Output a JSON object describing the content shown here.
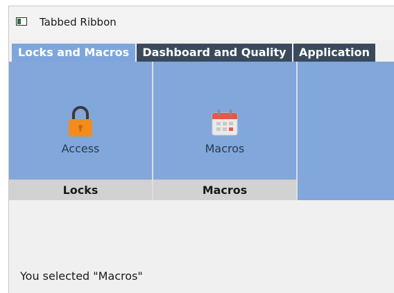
{
  "window": {
    "title": "Tabbed Ribbon",
    "icon": "window-app-icon"
  },
  "tabs": [
    {
      "label": "Locks and Macros",
      "active": true
    },
    {
      "label": "Dashboard and Quality",
      "active": false
    },
    {
      "label": "Application",
      "active": false
    }
  ],
  "ribbon": {
    "groups": [
      {
        "title": "Locks",
        "button": {
          "label": "Access",
          "icon": "lock-icon"
        }
      },
      {
        "title": "Macros",
        "button": {
          "label": "Macros",
          "icon": "calendar-icon"
        }
      }
    ]
  },
  "status": {
    "text": "You selected \"Macros\""
  },
  "colors": {
    "ribbon_background": "#81a7db",
    "active_tab": "#7fa6dc",
    "inactive_tab": "#3a4a5c",
    "group_footer": "#d2d2d2",
    "lock_orange": "#f28c1c",
    "calendar_red": "#e8564a"
  }
}
